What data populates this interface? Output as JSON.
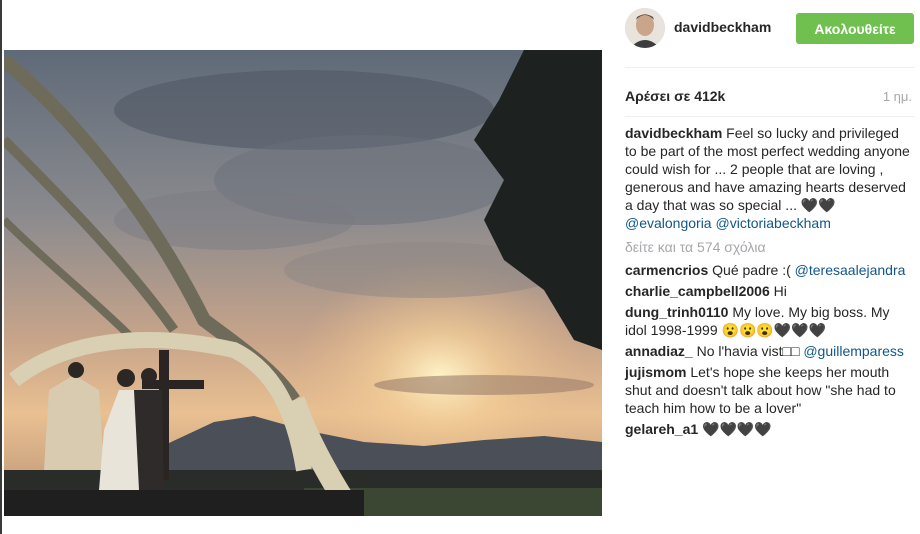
{
  "post": {
    "username": "davidbeckham",
    "follow_label": "Ακολουθείτε",
    "likes": "Αρέσει σε 412k",
    "timestamp": "1 ημ."
  },
  "caption": {
    "author": "davidbeckham",
    "text": "Feel so lucky and privileged to be part of the most perfect wedding anyone could wish for ... 2 people that are loving , generous and have amazing hearts deserved a day that was so special ... ",
    "hearts": "🖤🖤",
    "mention1": "@evalongoria",
    "mention2": "@victoriabeckham"
  },
  "more_comments": "δείτε και τα 574 σχόλια",
  "comments": [
    {
      "author": "carmencrios",
      "text": "Qué padre :(",
      "mention": "@teresaalejandra"
    },
    {
      "author": "charlie_campbell2006",
      "text": "Hi"
    },
    {
      "author": "dung_trinh0110",
      "text": "My love. My big boss. My idol 1998-1999 😮😮😮🖤🖤🖤"
    },
    {
      "author": "annadiaz_",
      "text": "No l'havia vist□□",
      "mention": "@guillemparess"
    },
    {
      "author": "jujismom",
      "text": "Let's hope she keeps her mouth shut and doesn't talk about how \"she had to teach him how to be a lover\""
    },
    {
      "author": "gelareh_a1",
      "text": "🖤🖤🖤🖤"
    }
  ],
  "icons": {
    "avatar": "profile-photo",
    "photo": "wedding-sunset-photo"
  },
  "colors": {
    "follow_button": "#70c050",
    "mention": "#125688",
    "muted": "#a5a7aa"
  }
}
